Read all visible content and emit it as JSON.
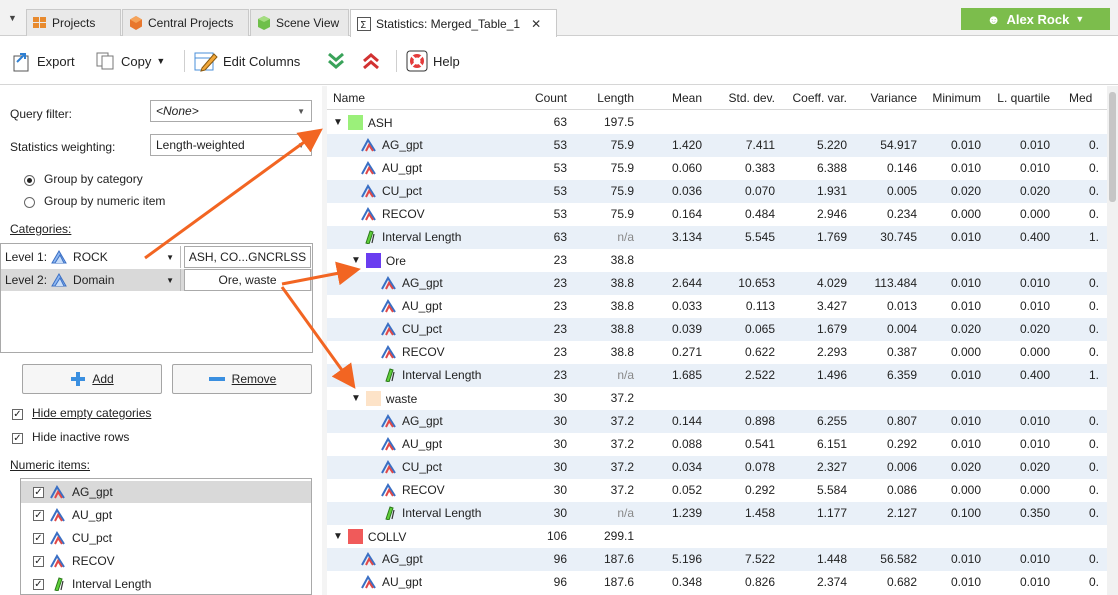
{
  "tabs": [
    {
      "label": "Projects",
      "icon": "grid-icon"
    },
    {
      "label": "Central Projects",
      "icon": "hexagon-icon"
    },
    {
      "label": "Scene View",
      "icon": "cube-icon"
    },
    {
      "label": "Statistics: Merged_Table_1",
      "icon": "statistics-icon",
      "close": "✕"
    }
  ],
  "user": {
    "name": "Alex Rock"
  },
  "toolbar": {
    "export": "Export",
    "copy": "Copy",
    "edit_columns": "Edit Columns",
    "help": "Help"
  },
  "left": {
    "query_filter_label": "Query filter:",
    "query_filter_value": "<None>",
    "weighting_label": "Statistics weighting:",
    "weighting_value": "Length-weighted",
    "group_category": "Group by category",
    "group_numeric": "Group by numeric item",
    "categories_label": "Categories:",
    "levels": [
      {
        "label": "Level 1:",
        "item": "ROCK",
        "value": "ASH, CO...GNCRLSS"
      },
      {
        "label": "Level 2:",
        "item": "Domain",
        "value": "Ore, waste"
      }
    ],
    "add": "Add",
    "remove": "Remove",
    "hide_empty": "Hide empty categories",
    "hide_inactive": "Hide inactive rows",
    "numeric_label": "Numeric items:",
    "numeric_items": [
      "AG_gpt",
      "AU_gpt",
      "CU_pct",
      "RECOV",
      "Interval Length"
    ]
  },
  "columns": [
    "Name",
    "Count",
    "Length",
    "Mean",
    "Std. dev.",
    "Coeff. var.",
    "Variance",
    "Minimum",
    "L. quartile",
    "Med"
  ],
  "rows": [
    {
      "type": "group",
      "level": 0,
      "name": "ASH",
      "color": "#9bf07a",
      "count": "63",
      "length": "197.5"
    },
    {
      "type": "item",
      "level": 0,
      "icon": "assay",
      "name": "AG_gpt",
      "count": "53",
      "length": "75.9",
      "mean": "1.420",
      "std": "7.411",
      "cv": "5.220",
      "var": "54.917",
      "min": "0.010",
      "lq": "0.010",
      "med": "0."
    },
    {
      "type": "item",
      "level": 0,
      "icon": "assay",
      "name": "AU_gpt",
      "count": "53",
      "length": "75.9",
      "mean": "0.060",
      "std": "0.383",
      "cv": "6.388",
      "var": "0.146",
      "min": "0.010",
      "lq": "0.010",
      "med": "0."
    },
    {
      "type": "item",
      "level": 0,
      "icon": "assay",
      "name": "CU_pct",
      "count": "53",
      "length": "75.9",
      "mean": "0.036",
      "std": "0.070",
      "cv": "1.931",
      "var": "0.005",
      "min": "0.020",
      "lq": "0.020",
      "med": "0."
    },
    {
      "type": "item",
      "level": 0,
      "icon": "assay",
      "name": "RECOV",
      "count": "53",
      "length": "75.9",
      "mean": "0.164",
      "std": "0.484",
      "cv": "2.946",
      "var": "0.234",
      "min": "0.000",
      "lq": "0.000",
      "med": "0."
    },
    {
      "type": "item",
      "level": 0,
      "icon": "interval",
      "name": "Interval Length",
      "count": "63",
      "length": "n/a",
      "mean": "3.134",
      "std": "5.545",
      "cv": "1.769",
      "var": "30.745",
      "min": "0.010",
      "lq": "0.400",
      "med": "1."
    },
    {
      "type": "group",
      "level": 1,
      "name": "Ore",
      "color": "#6a3df0",
      "count": "23",
      "length": "38.8"
    },
    {
      "type": "item",
      "level": 1,
      "icon": "assay",
      "name": "AG_gpt",
      "count": "23",
      "length": "38.8",
      "mean": "2.644",
      "std": "10.653",
      "cv": "4.029",
      "var": "113.484",
      "min": "0.010",
      "lq": "0.010",
      "med": "0."
    },
    {
      "type": "item",
      "level": 1,
      "icon": "assay",
      "name": "AU_gpt",
      "count": "23",
      "length": "38.8",
      "mean": "0.033",
      "std": "0.113",
      "cv": "3.427",
      "var": "0.013",
      "min": "0.010",
      "lq": "0.010",
      "med": "0."
    },
    {
      "type": "item",
      "level": 1,
      "icon": "assay",
      "name": "CU_pct",
      "count": "23",
      "length": "38.8",
      "mean": "0.039",
      "std": "0.065",
      "cv": "1.679",
      "var": "0.004",
      "min": "0.020",
      "lq": "0.020",
      "med": "0."
    },
    {
      "type": "item",
      "level": 1,
      "icon": "assay",
      "name": "RECOV",
      "count": "23",
      "length": "38.8",
      "mean": "0.271",
      "std": "0.622",
      "cv": "2.293",
      "var": "0.387",
      "min": "0.000",
      "lq": "0.000",
      "med": "0."
    },
    {
      "type": "item",
      "level": 1,
      "icon": "interval",
      "name": "Interval Length",
      "count": "23",
      "length": "n/a",
      "mean": "1.685",
      "std": "2.522",
      "cv": "1.496",
      "var": "6.359",
      "min": "0.010",
      "lq": "0.400",
      "med": "1."
    },
    {
      "type": "group",
      "level": 1,
      "name": "waste",
      "color": "#fde3c8",
      "count": "30",
      "length": "37.2"
    },
    {
      "type": "item",
      "level": 1,
      "icon": "assay",
      "name": "AG_gpt",
      "count": "30",
      "length": "37.2",
      "mean": "0.144",
      "std": "0.898",
      "cv": "6.255",
      "var": "0.807",
      "min": "0.010",
      "lq": "0.010",
      "med": "0."
    },
    {
      "type": "item",
      "level": 1,
      "icon": "assay",
      "name": "AU_gpt",
      "count": "30",
      "length": "37.2",
      "mean": "0.088",
      "std": "0.541",
      "cv": "6.151",
      "var": "0.292",
      "min": "0.010",
      "lq": "0.010",
      "med": "0."
    },
    {
      "type": "item",
      "level": 1,
      "icon": "assay",
      "name": "CU_pct",
      "count": "30",
      "length": "37.2",
      "mean": "0.034",
      "std": "0.078",
      "cv": "2.327",
      "var": "0.006",
      "min": "0.020",
      "lq": "0.020",
      "med": "0."
    },
    {
      "type": "item",
      "level": 1,
      "icon": "assay",
      "name": "RECOV",
      "count": "30",
      "length": "37.2",
      "mean": "0.052",
      "std": "0.292",
      "cv": "5.584",
      "var": "0.086",
      "min": "0.000",
      "lq": "0.000",
      "med": "0."
    },
    {
      "type": "item",
      "level": 1,
      "icon": "interval",
      "name": "Interval Length",
      "count": "30",
      "length": "n/a",
      "mean": "1.239",
      "std": "1.458",
      "cv": "1.177",
      "var": "2.127",
      "min": "0.100",
      "lq": "0.350",
      "med": "0."
    },
    {
      "type": "group",
      "level": 0,
      "name": "COLLV",
      "color": "#f05a5a",
      "count": "106",
      "length": "299.1"
    },
    {
      "type": "item",
      "level": 0,
      "icon": "assay",
      "name": "AG_gpt",
      "count": "96",
      "length": "187.6",
      "mean": "5.196",
      "std": "7.522",
      "cv": "1.448",
      "var": "56.582",
      "min": "0.010",
      "lq": "0.010",
      "med": "0."
    },
    {
      "type": "item",
      "level": 0,
      "icon": "assay",
      "name": "AU_gpt",
      "count": "96",
      "length": "187.6",
      "mean": "0.348",
      "std": "0.826",
      "cv": "2.374",
      "var": "0.682",
      "min": "0.010",
      "lq": "0.010",
      "med": "0."
    }
  ],
  "colors": {
    "accent": "#7cbd4c",
    "row_alt": "#e9f0f8",
    "arrow": "#f26522"
  }
}
